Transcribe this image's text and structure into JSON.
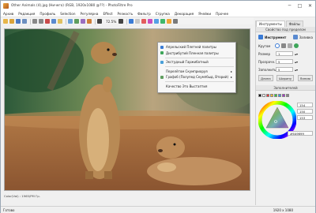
{
  "titlebar": {
    "title": "Other Animals (4).jpg (Ничего) (RGB, 1920x1080 @??) - PhotoFiltre Pro",
    "minimize": "─",
    "maximize": "□",
    "close": "✕"
  },
  "menu": [
    "Архив",
    "Редакция",
    "Профиль",
    "Selection",
    "Регулярна",
    "Effect",
    "Резкость",
    "Фильтр",
    "Сгрупка",
    "Декорация",
    "Ячейки",
    "Прочее"
  ],
  "toolbar": {
    "zoom": "72.5%"
  },
  "context_menu": {
    "items": [
      {
        "label": "Апрельский Плетней палитры",
        "has_sub": false
      },
      {
        "label": "Дистрибутий Пленная палитры",
        "has_sub": false
      },
      {
        "label": "Экстудный Гаржибатный",
        "has_sub": false
      },
      {
        "label": "Перелётом Скумприоруя",
        "has_sub": true
      },
      {
        "label": "Графоб (Полупед Скумпбыд, Вторий)",
        "has_sub": true
      },
      {
        "label": "Качество Это Выстаптия",
        "has_sub": false
      }
    ]
  },
  "panel": {
    "tabs": [
      "Инструменты",
      "Файлы"
    ],
    "title": "Свойство под пределом",
    "tool_label": "Инструмент",
    "tool_value": "Заливка",
    "shape_label": "Кругом",
    "size_label": "Размер",
    "size_value": "1",
    "opacity_label": "Прозрачн.",
    "opacity_value": "5",
    "angle_label": "Заполнить",
    "angle_value": "5",
    "btn_left": "Длина",
    "btn_mid": "Ширину",
    "btn_right": "Линию",
    "colors_title": "Заполнителей",
    "rgb": [
      "154",
      "150",
      "153"
    ],
    "hex": "#9A9699"
  },
  "infobar": {
    "text": "Color(Val) : 1965/PM Гр."
  },
  "status": {
    "left": "Готово",
    "right": "1920 x 1080"
  },
  "colors": {
    "accent": "#3a7bd5",
    "highlight": "#cfe3f7"
  }
}
